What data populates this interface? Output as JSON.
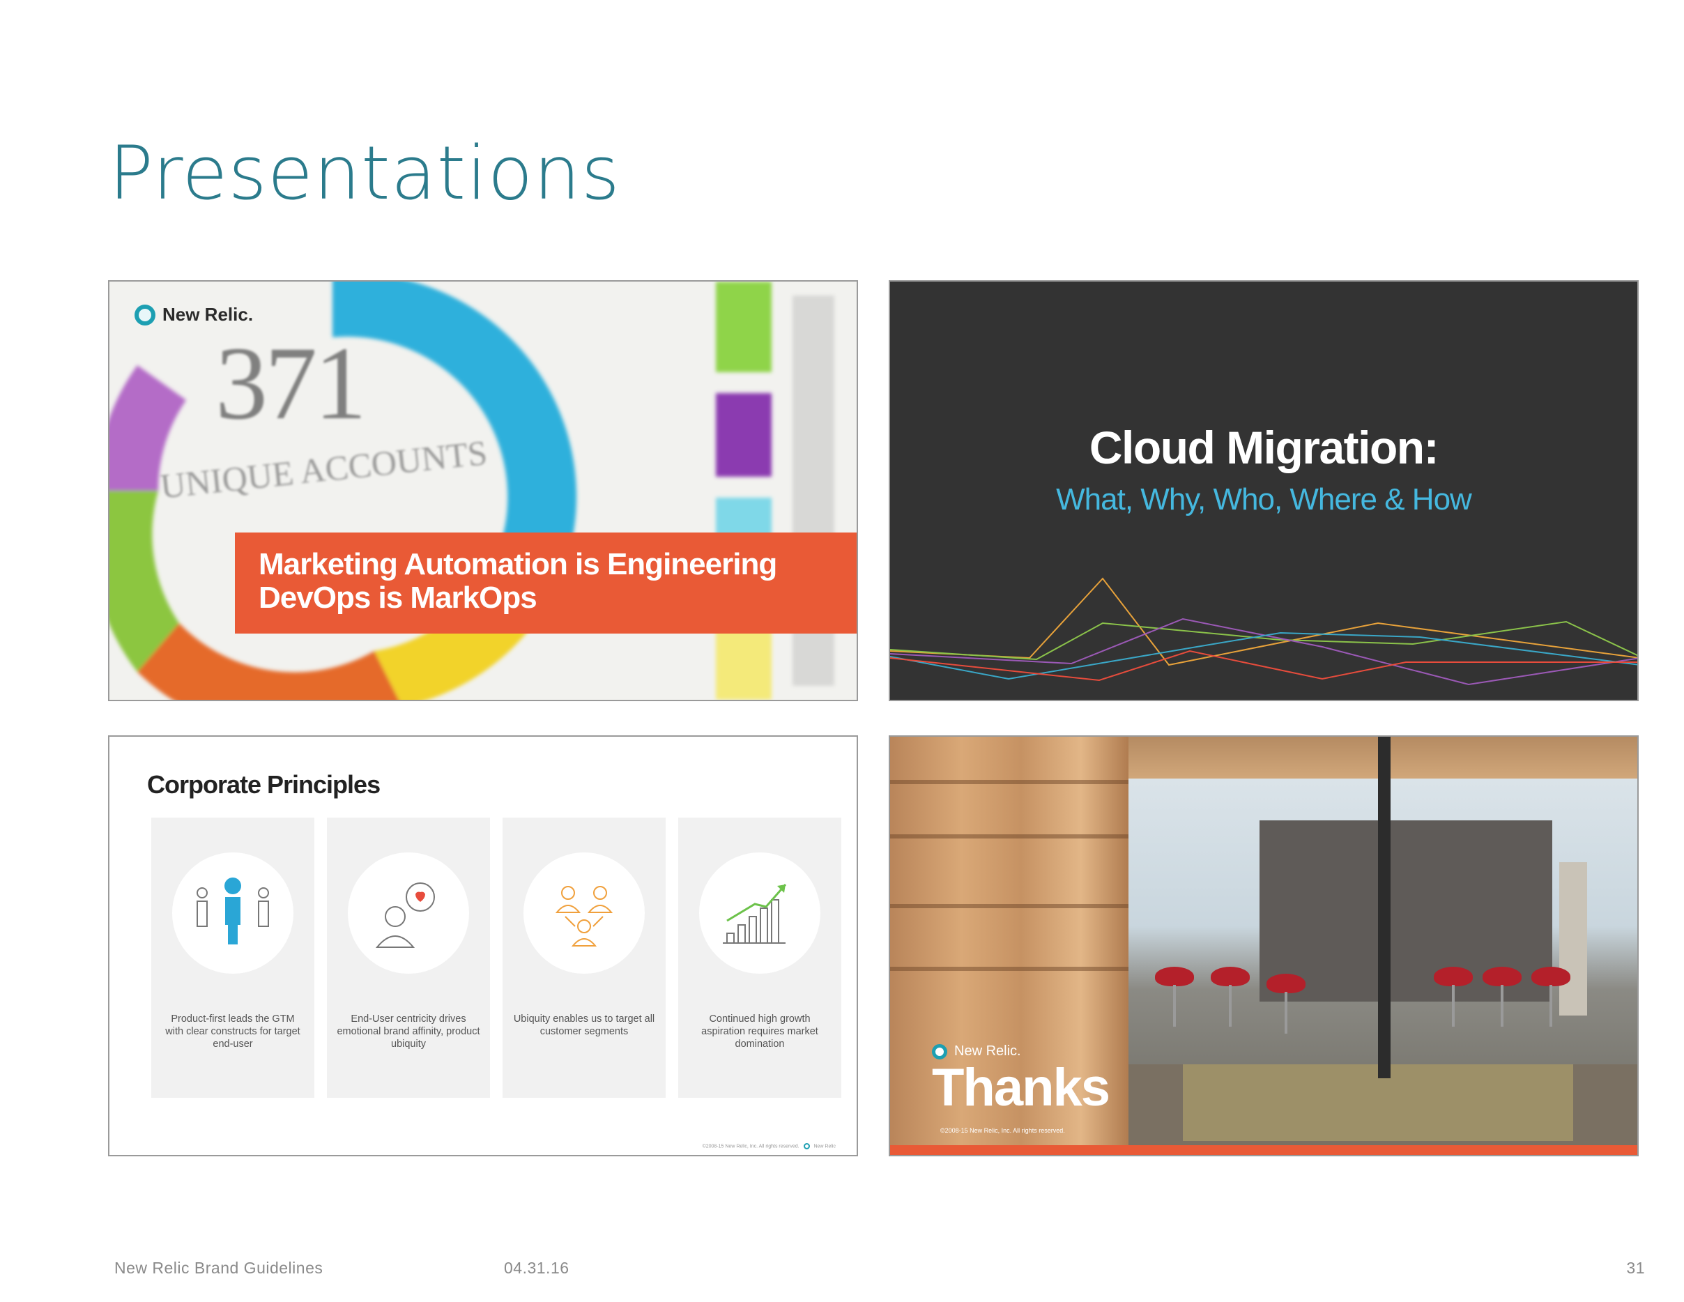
{
  "page": {
    "title": "Presentations",
    "footer": {
      "doc_name": "New Relic Brand Guidelines",
      "date": "04.31.16",
      "page_number": "31"
    }
  },
  "slides": [
    {
      "logo_text": "New Relic.",
      "background_number": "371",
      "background_label": "UNIQUE ACCOUNTS",
      "headline_line1": "Marketing Automation is Engineering",
      "headline_line2": "DevOps is MarkOps",
      "accent_color": "#e95a36"
    },
    {
      "title": "Cloud Migration:",
      "subtitle": "What, Why, Who, Where & How",
      "line_colors": [
        "#e8a23a",
        "#8bc34a",
        "#9b59b6",
        "#3aa7c7",
        "#e74c3c"
      ]
    },
    {
      "title": "Corporate Principles",
      "cards": [
        {
          "icon": "people-icon",
          "text": "Product-first leads the GTM with clear constructs for target end-user"
        },
        {
          "icon": "heart-chat-icon",
          "text": "End-User centricity drives emotional brand affinity, product ubiquity"
        },
        {
          "icon": "network-people-icon",
          "text": "Ubiquity enables us to target all customer segments"
        },
        {
          "icon": "growth-chart-icon",
          "text": "Continued high growth aspiration requires market domination"
        }
      ],
      "footer_text": "©2008-15 New Relic, Inc. All rights reserved.",
      "footer_logo": "New Relic"
    },
    {
      "logo_text": "New Relic.",
      "title": "Thanks",
      "copyright": "©2008-15 New Relic, Inc. All rights reserved.",
      "accent_color": "#e95a36"
    }
  ]
}
